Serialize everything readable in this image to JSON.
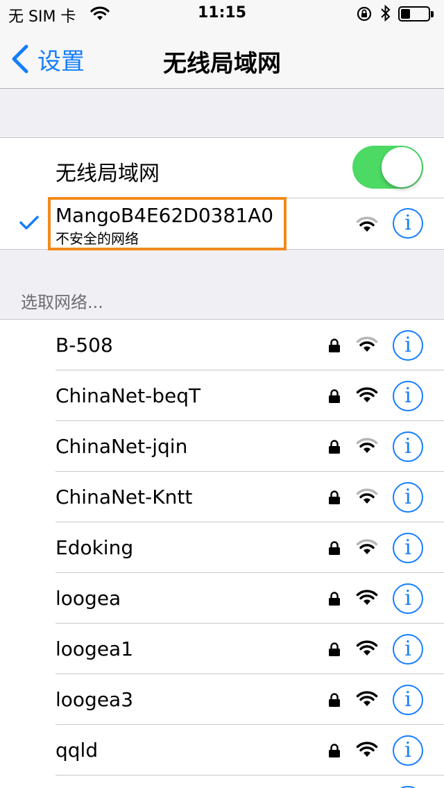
{
  "status_bar": {
    "carrier": "无 SIM 卡",
    "time": "11:15",
    "battery_level": 0.35
  },
  "nav": {
    "back_label": "设置",
    "title": "无线局域网"
  },
  "wifi_toggle": {
    "label": "无线局域网",
    "on": true
  },
  "connected": {
    "name": "MangoB4E62D0381A0",
    "subtitle": "不安全的网络",
    "signal": "weak"
  },
  "section_header": "选取网络...",
  "networks": [
    {
      "name": "B-508",
      "locked": true,
      "signal": "weak"
    },
    {
      "name": "ChinaNet-beqT",
      "locked": true,
      "signal": "strong"
    },
    {
      "name": "ChinaNet-jqin",
      "locked": true,
      "signal": "weak"
    },
    {
      "name": "ChinaNet-Kntt",
      "locked": true,
      "signal": "weak"
    },
    {
      "name": "Edoking",
      "locked": true,
      "signal": "weak"
    },
    {
      "name": "loogea",
      "locked": true,
      "signal": "strong"
    },
    {
      "name": "loogea1",
      "locked": true,
      "signal": "strong"
    },
    {
      "name": "loogea3",
      "locked": true,
      "signal": "strong"
    },
    {
      "name": "qqld",
      "locked": true,
      "signal": "strong"
    },
    {
      "name": "",
      "locked": true,
      "signal": "strong"
    }
  ],
  "info_glyph": "i",
  "colors": {
    "accent": "#147efb",
    "toggle_on": "#4cd964",
    "highlight": "#f28a1c"
  }
}
